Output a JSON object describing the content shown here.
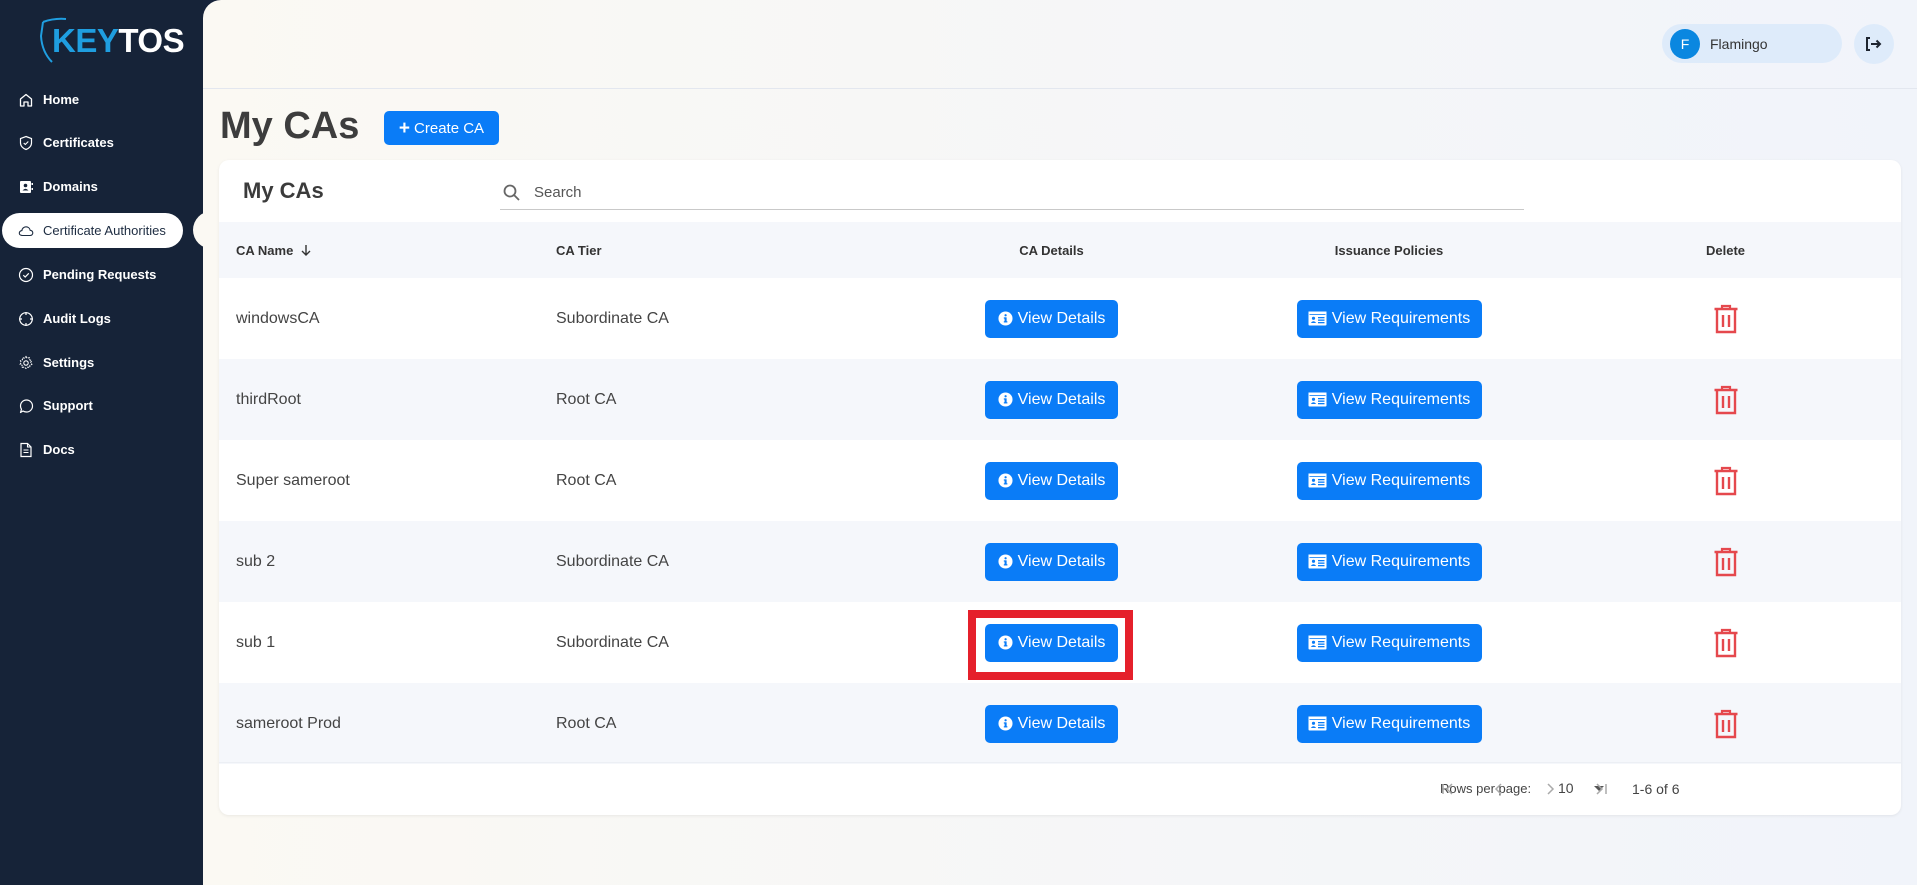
{
  "brand": {
    "part1": "KEY",
    "part2": "TOS"
  },
  "sidebar": {
    "items": [
      {
        "label": "Home",
        "icon": "home-icon"
      },
      {
        "label": "Certificates",
        "icon": "shield-check-icon"
      },
      {
        "label": "Domains",
        "icon": "contact-book-icon"
      },
      {
        "label": "Certificate Authorities",
        "icon": "cloud-icon",
        "active": true
      },
      {
        "label": "Pending Requests",
        "icon": "check-circle-icon"
      },
      {
        "label": "Audit Logs",
        "icon": "crosshair-icon"
      },
      {
        "label": "Settings",
        "icon": "gear-icon"
      },
      {
        "label": "Support",
        "icon": "chat-bubble-icon"
      },
      {
        "label": "Docs",
        "icon": "document-icon"
      }
    ]
  },
  "header": {
    "user_initial": "F",
    "user_name": "Flamingo",
    "logout_icon": "logout-icon"
  },
  "page": {
    "title": "My CAs",
    "create_button": "Create CA"
  },
  "card": {
    "title": "My CAs",
    "search_placeholder": "Search",
    "search_value": ""
  },
  "table": {
    "columns": {
      "name": "CA Name",
      "tier": "CA Tier",
      "details": "CA Details",
      "policies": "Issuance Policies",
      "delete": "Delete"
    },
    "sort": {
      "column": "CA Name",
      "direction": "descending"
    },
    "details_button": "View Details",
    "policies_button": "View Requirements",
    "rows": [
      {
        "name": "windowsCA",
        "tier": "Subordinate CA"
      },
      {
        "name": "thirdRoot",
        "tier": "Root CA"
      },
      {
        "name": "Super sameroot",
        "tier": "Root CA"
      },
      {
        "name": "sub 2",
        "tier": "Subordinate CA"
      },
      {
        "name": "sub 1",
        "tier": "Subordinate CA",
        "highlighted": true
      },
      {
        "name": "sameroot Prod",
        "tier": "Root CA"
      }
    ]
  },
  "pagination": {
    "rows_per_page_label": "Rows per page:",
    "rows_per_page": "10",
    "range": "1-6 of 6"
  },
  "colors": {
    "sidebar_bg": "#162338",
    "primary": "#0a7cf7",
    "danger": "#e5484d",
    "highlight": "#e5202b",
    "brand_blue": "#1f9ee0"
  }
}
